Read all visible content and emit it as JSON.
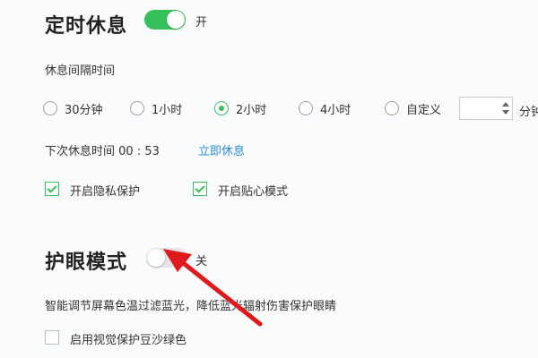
{
  "scheduled_rest": {
    "title": "定时休息",
    "toggle_state": "开",
    "toggle_on": true,
    "interval_label": "休息间隔时间",
    "options": [
      "30分钟",
      "1小时",
      "2小时",
      "4小时",
      "自定义"
    ],
    "selected_option": "2小时",
    "custom_value": "",
    "custom_unit": "分钟",
    "next_rest_label": "下次休息时间 00 : 53",
    "rest_now_link": "立即休息",
    "privacy_protection_label": "开启隐私保护",
    "privacy_protection_checked": true,
    "caring_mode_label": "开启贴心模式",
    "caring_mode_checked": true
  },
  "eye_care": {
    "title": "护眼模式",
    "toggle_state": "关",
    "toggle_on": false,
    "description": "智能调节屏幕色温过滤蓝光，降低蓝光辐射伤害保护眼睛",
    "green_background_label": "启用视觉保护豆沙绿色",
    "green_background_checked": false
  },
  "annotation": {
    "arrow_color": "#e0191c"
  },
  "colors": {
    "accent": "#35c05b",
    "link": "#2a8fd6",
    "toggle_off": "#e3e5e8"
  }
}
